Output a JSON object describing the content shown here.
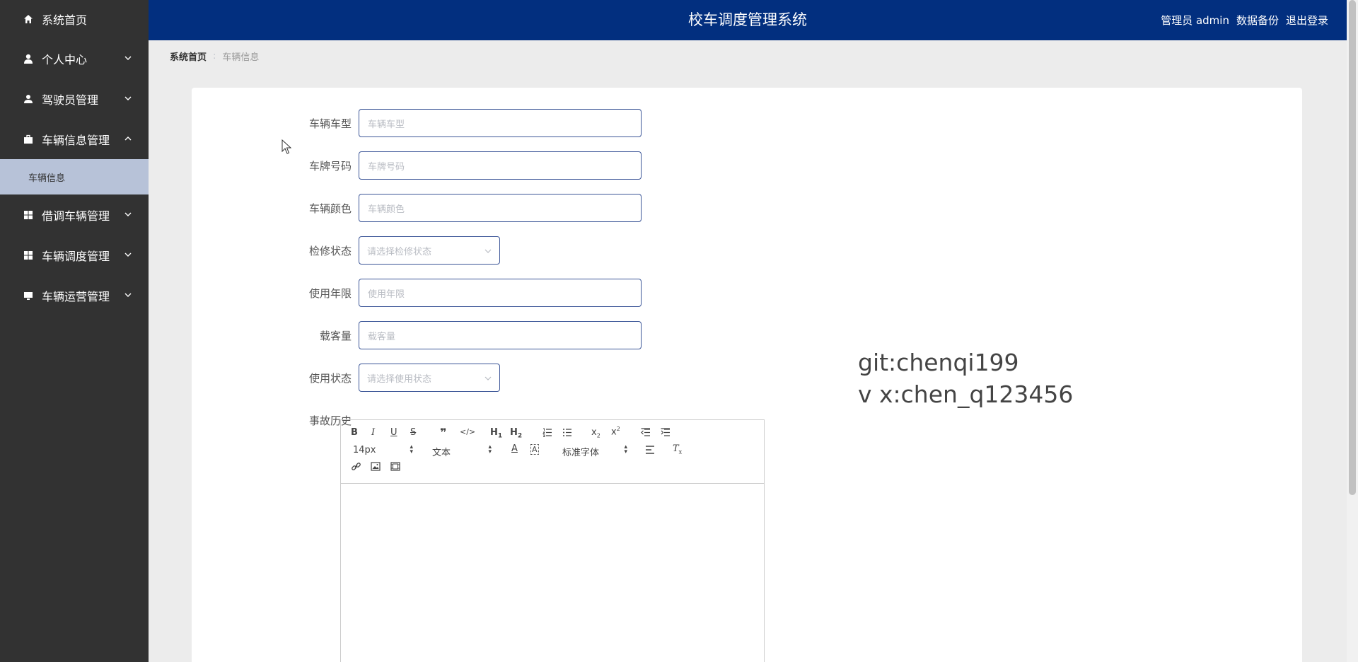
{
  "sidebar": {
    "items": [
      {
        "label": "系统首页",
        "icon": "home-icon"
      },
      {
        "label": "个人中心",
        "icon": "user-icon"
      },
      {
        "label": "驾驶员管理",
        "icon": "driver-icon"
      },
      {
        "label": "车辆信息管理",
        "icon": "briefcase-icon"
      },
      {
        "label": "借调车辆管理",
        "icon": "grid-icon"
      },
      {
        "label": "车辆调度管理",
        "icon": "grid-icon"
      },
      {
        "label": "车辆运营管理",
        "icon": "monitor-icon"
      }
    ],
    "sub_items": [
      {
        "label": "车辆信息"
      }
    ]
  },
  "header": {
    "title": "校车调度管理系统",
    "user": "管理员 admin",
    "backup": "数据备份",
    "logout": "退出登录"
  },
  "breadcrumb": {
    "home": "系统首页",
    "current": "车辆信息"
  },
  "form": {
    "fields": [
      {
        "label": "车辆车型",
        "placeholder": "车辆车型"
      },
      {
        "label": "车牌号码",
        "placeholder": "车牌号码"
      },
      {
        "label": "车辆颜色",
        "placeholder": "车辆颜色"
      },
      {
        "label": "检修状态",
        "placeholder": "请选择检修状态"
      },
      {
        "label": "使用年限",
        "placeholder": "使用年限"
      },
      {
        "label": "载客量",
        "placeholder": "载客量"
      },
      {
        "label": "使用状态",
        "placeholder": "请选择使用状态"
      },
      {
        "label": "事故历史"
      }
    ]
  },
  "editor": {
    "font_size": "14px",
    "block_type": "文本",
    "font_family": "标准字体"
  },
  "watermark": {
    "line1": "git:chenqi199",
    "line2": "v x:chen_q123456"
  },
  "colors": {
    "sidebar_bg": "#323232",
    "header_bg": "#022f7f",
    "active_sub_bg": "#b7c2d8",
    "input_border": "#3b5597"
  }
}
